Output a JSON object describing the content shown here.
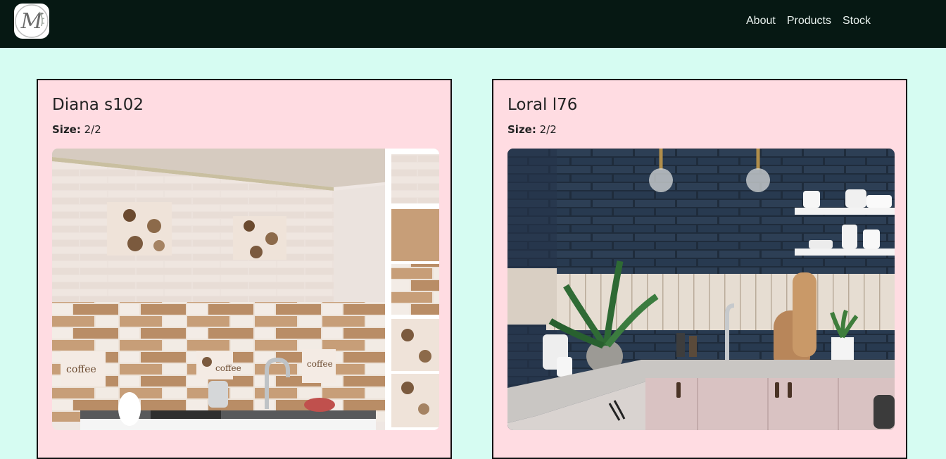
{
  "navbar": {
    "links": [
      "About",
      "Products",
      "Stock"
    ],
    "logo_letter": "M"
  },
  "products": [
    {
      "name": "Diana s102",
      "size_label": "Size:",
      "size_value": "2/2",
      "image_label": "coffee"
    },
    {
      "name": "Loral l76",
      "size_label": "Size:",
      "size_value": "2/2"
    }
  ]
}
